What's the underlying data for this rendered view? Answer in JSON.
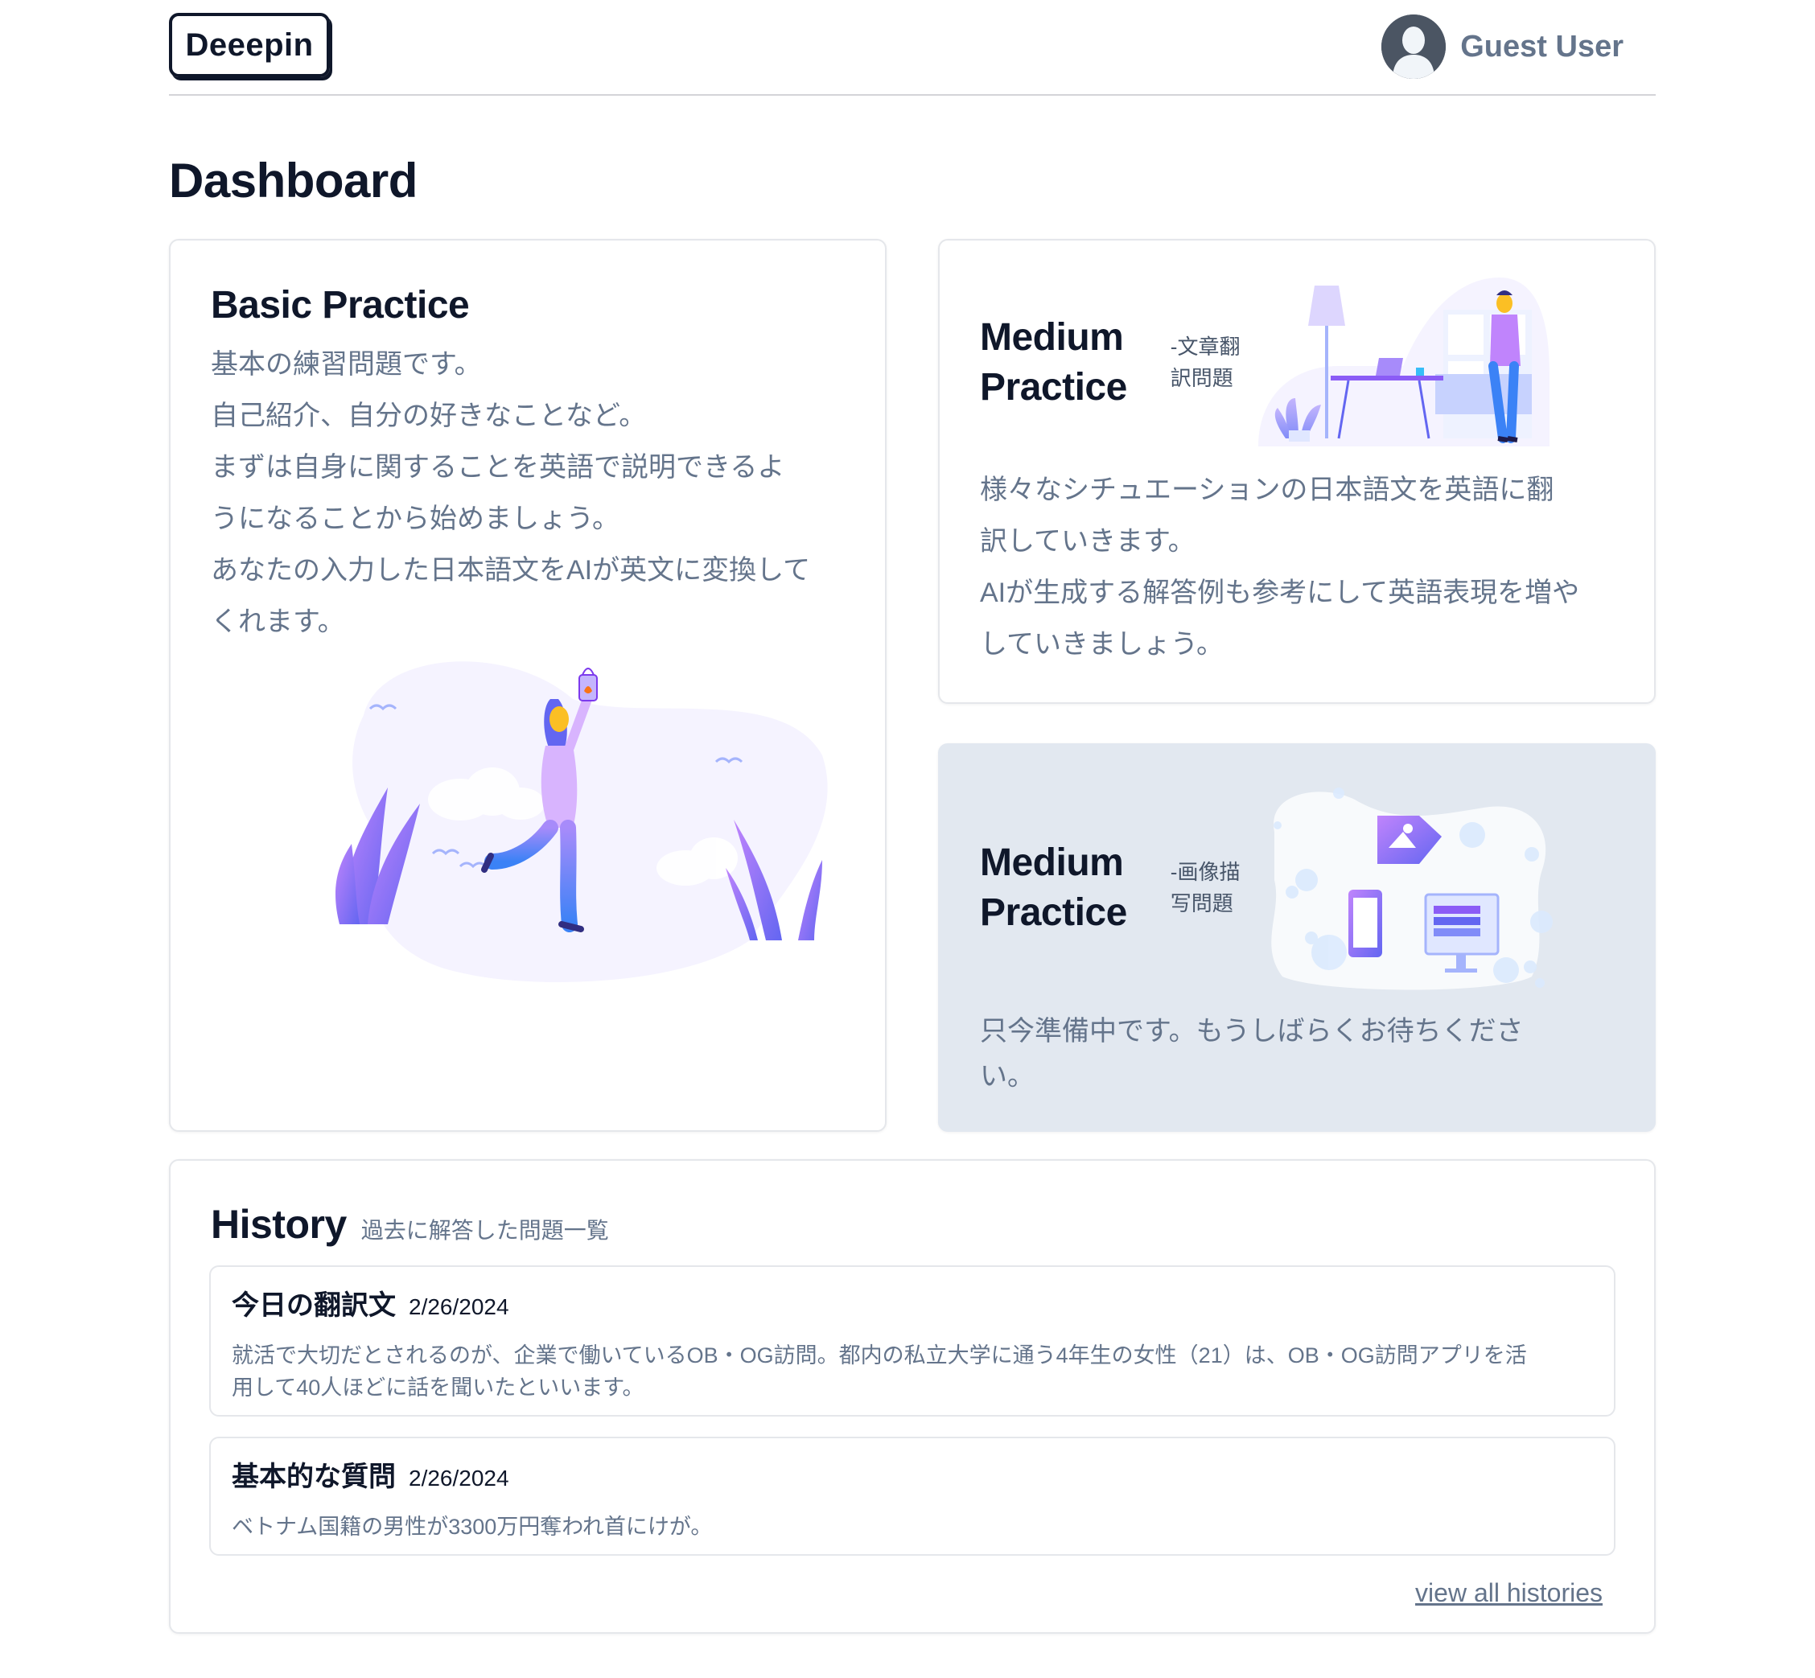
{
  "header": {
    "logo": "Deeepin",
    "user_name": "Guest User"
  },
  "page_title": "Dashboard",
  "cards": [
    {
      "title": "Basic Practice",
      "description": [
        "基本の練習問題です。",
        "自己紹介、自分の好きなことなど。",
        "まずは自身に関することを英語で説明できるよ",
        "うになることから始めましょう。",
        "あなたの入力した日本語文をAIが英文に変換して",
        "くれます。"
      ]
    },
    {
      "title_line1": "Medium",
      "title_line2": "Practice",
      "subtitle_line1": "-文章翻",
      "subtitle_line2": "訳問題",
      "description": [
        "様々なシチュエーションの日本語文を英語に翻",
        "訳していきます。",
        "AIが生成する解答例も参考にして英語表現を増や",
        "していきましょう。"
      ]
    },
    {
      "title_line1": "Medium",
      "title_line2": "Practice",
      "subtitle_line1": "-画像描",
      "subtitle_line2": "写問題",
      "description": [
        "只今準備中です。もうしばらくお待ちくださ",
        "い。"
      ]
    }
  ],
  "history": {
    "title": "History",
    "subtitle": "過去に解答した問題一覧",
    "items": [
      {
        "title": "今日の翻訳文",
        "date": "2/26/2024",
        "body_line1": "就活で大切だとされるのが、企業で働いているOB・OG訪問。都内の私立大学に通う4年生の女性（21）は、OB・OG訪問アプリを活",
        "body_line2": "用して40人ほどに話を聞いたといいます。"
      },
      {
        "title": "基本的な質問",
        "date": "2/26/2024",
        "body_line1": "ベトナム国籍の男性が3300万円奪われ首にけが。"
      }
    ],
    "view_all": "view all histories"
  },
  "colors": {
    "accent_purple": "#a78bfa",
    "accent_blue": "#6366f1",
    "text_muted": "#64748b",
    "disabled_bg": "#e2e8f0"
  },
  "icons": {
    "avatar": "user-silhouette-icon"
  }
}
